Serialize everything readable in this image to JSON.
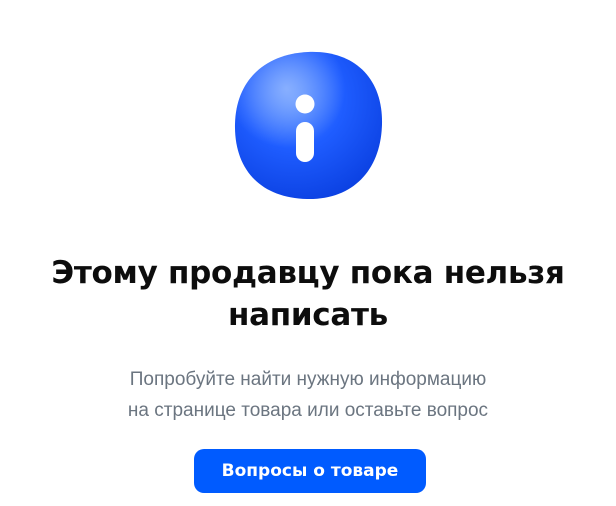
{
  "empty_state": {
    "icon": "info-icon",
    "title_line1": "Этому продавцу пока нельзя",
    "title_line2": "написать",
    "subtitle_line1": "Попробуйте найти нужную информацию",
    "subtitle_line2": "на странице товара или оставьте вопрос",
    "button_label": "Вопросы о товаре"
  },
  "colors": {
    "accent": "#005bff",
    "icon_blue": "#1a5bff",
    "title": "#0d0d0d",
    "subtitle": "#6b7580"
  }
}
